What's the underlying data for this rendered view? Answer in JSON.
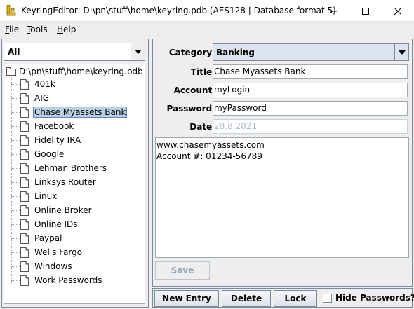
{
  "window": {
    "title": "KeyringEditor: D:\\pn\\stuff\\home\\keyring.pdb (AES128 | Database format 5)",
    "app_icon": "key-icon",
    "controls": [
      "minimize-icon",
      "maximize-icon",
      "close-icon"
    ]
  },
  "menu": [
    {
      "underline": "F",
      "rest": "ile"
    },
    {
      "underline": "T",
      "rest": "ools"
    },
    {
      "underline": "H",
      "rest": "elp"
    }
  ],
  "filter": {
    "value": "All"
  },
  "tree": {
    "root": "D:\\pn\\stuff\\home\\keyring.pdb",
    "items": [
      "401k",
      "AIG",
      "Chase Myassets Bank",
      "Facebook",
      "Fidelity IRA",
      "Google",
      "Lehman Brothers",
      "Linksys Router",
      "Linux",
      "Online Broker",
      "Online IDs",
      "Paypal",
      "Wells Fargo",
      "Windows",
      "Work Passwords"
    ],
    "selected": "Chase Myassets Bank"
  },
  "form": {
    "category_label": "Category:",
    "category_value": "Banking",
    "title_label": "Title:",
    "title_value": "Chase Myassets Bank",
    "account_label": "Account:",
    "account_value": "myLogin",
    "password_label": "Password:",
    "password_value": "myPassword",
    "date_label": "Date:",
    "date_value": "28.8.2021",
    "notes": "www.chasemyassets.com\nAccount #: 01234-56789",
    "save_label": "Save"
  },
  "actions": {
    "new_entry": "New Entry",
    "delete": "Delete",
    "lock": "Lock",
    "hide_passwords": "Hide Passwords?"
  },
  "colors": {
    "selection_bg": "#b8cfe5",
    "panel_bg": "#eeeeee",
    "border": "#7a8a99"
  }
}
